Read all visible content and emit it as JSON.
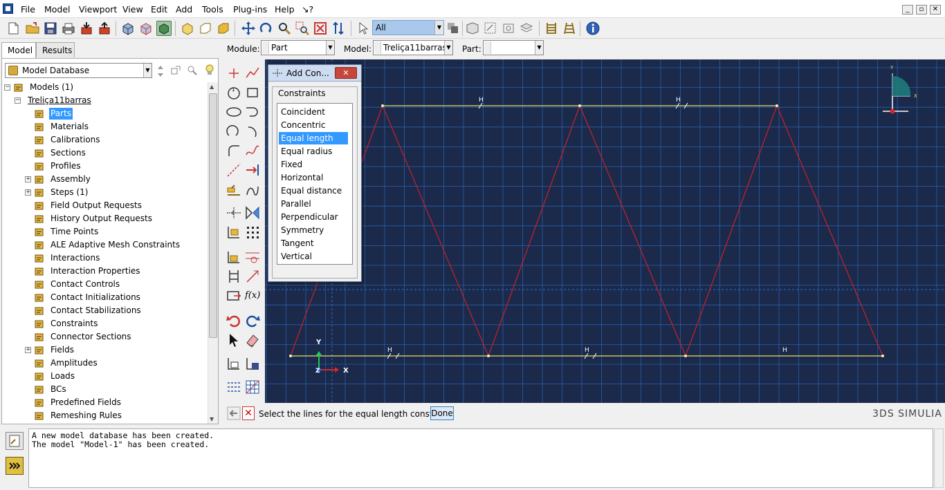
{
  "menubar": {
    "items": [
      "File",
      "Model",
      "Viewport",
      "View",
      "Edit",
      "Add",
      "Tools",
      "Plug-ins",
      "Help",
      "↘?"
    ]
  },
  "toolbar": {
    "selection_filter": "All"
  },
  "left_panel": {
    "tabs": [
      "Model",
      "Results"
    ],
    "database_label": "Model Database",
    "tree": [
      {
        "label": "Models (1)",
        "indent": 0,
        "expander": "-",
        "icon": "models-icon"
      },
      {
        "label": "Treliça11barras",
        "indent": 1,
        "expander": "-",
        "icon": ""
      },
      {
        "label": "Parts",
        "indent": 2,
        "expander": "",
        "icon": "parts-icon",
        "selected": true
      },
      {
        "label": "Materials",
        "indent": 2,
        "expander": "",
        "icon": "materials-icon"
      },
      {
        "label": "Calibrations",
        "indent": 2,
        "expander": "",
        "icon": "calibrations-icon"
      },
      {
        "label": "Sections",
        "indent": 2,
        "expander": "",
        "icon": "sections-icon"
      },
      {
        "label": "Profiles",
        "indent": 2,
        "expander": "",
        "icon": "profiles-icon"
      },
      {
        "label": "Assembly",
        "indent": 2,
        "expander": "+",
        "icon": "assembly-icon"
      },
      {
        "label": "Steps (1)",
        "indent": 2,
        "expander": "+",
        "icon": "steps-icon"
      },
      {
        "label": "Field Output Requests",
        "indent": 2,
        "expander": "",
        "icon": "field-output-icon"
      },
      {
        "label": "History Output Requests",
        "indent": 2,
        "expander": "",
        "icon": "history-output-icon"
      },
      {
        "label": "Time Points",
        "indent": 2,
        "expander": "",
        "icon": "time-points-icon"
      },
      {
        "label": "ALE Adaptive Mesh Constraints",
        "indent": 2,
        "expander": "",
        "icon": "ale-icon"
      },
      {
        "label": "Interactions",
        "indent": 2,
        "expander": "",
        "icon": "interactions-icon"
      },
      {
        "label": "Interaction Properties",
        "indent": 2,
        "expander": "",
        "icon": "interaction-properties-icon"
      },
      {
        "label": "Contact Controls",
        "indent": 2,
        "expander": "",
        "icon": "contact-controls-icon"
      },
      {
        "label": "Contact Initializations",
        "indent": 2,
        "expander": "",
        "icon": "contact-init-icon"
      },
      {
        "label": "Contact Stabilizations",
        "indent": 2,
        "expander": "",
        "icon": "contact-stab-icon"
      },
      {
        "label": "Constraints",
        "indent": 2,
        "expander": "",
        "icon": "constraints-icon"
      },
      {
        "label": "Connector Sections",
        "indent": 2,
        "expander": "",
        "icon": "connector-icon"
      },
      {
        "label": "Fields",
        "indent": 2,
        "expander": "+",
        "icon": "fields-icon"
      },
      {
        "label": "Amplitudes",
        "indent": 2,
        "expander": "",
        "icon": "amplitudes-icon"
      },
      {
        "label": "Loads",
        "indent": 2,
        "expander": "",
        "icon": "loads-icon"
      },
      {
        "label": "BCs",
        "indent": 2,
        "expander": "",
        "icon": "bcs-icon"
      },
      {
        "label": "Predefined Fields",
        "indent": 2,
        "expander": "",
        "icon": "predefined-icon"
      },
      {
        "label": "Remeshing Rules",
        "indent": 2,
        "expander": "",
        "icon": "remeshing-icon"
      }
    ]
  },
  "context_bar": {
    "module_label": "Module:",
    "module_value": "Part",
    "model_label": "Model:",
    "model_value": "Treliça11barras",
    "part_label": "Part:",
    "part_value": ""
  },
  "toolbox_fx": "f(x)",
  "dialog": {
    "title": "Add Con...",
    "group_label": "Constraints",
    "options": [
      "Coincident",
      "Concentric",
      "Equal length",
      "Equal radius",
      "Fixed",
      "Horizontal",
      "Equal distance",
      "Parallel",
      "Perpendicular",
      "Symmetry",
      "Tangent",
      "Vertical"
    ],
    "selected_index": 2
  },
  "viewport": {
    "marker_h": "H",
    "triad": {
      "x": "X",
      "y": "Y",
      "z": "Z"
    },
    "view_triad_y": "Y",
    "view_triad_x": "X",
    "colors": {
      "background": "#1b2a4a",
      "grid": "#2e6fd0",
      "sketch": "#cc1f2a",
      "horizontal": "#e8e060"
    }
  },
  "prompt": {
    "text": "Select the lines for the equal length constraint",
    "done_label": "Done",
    "brand": "3DS SIMULIA"
  },
  "messages": [
    "A new model database has been created.",
    "The model \"Model-1\" has been created."
  ]
}
